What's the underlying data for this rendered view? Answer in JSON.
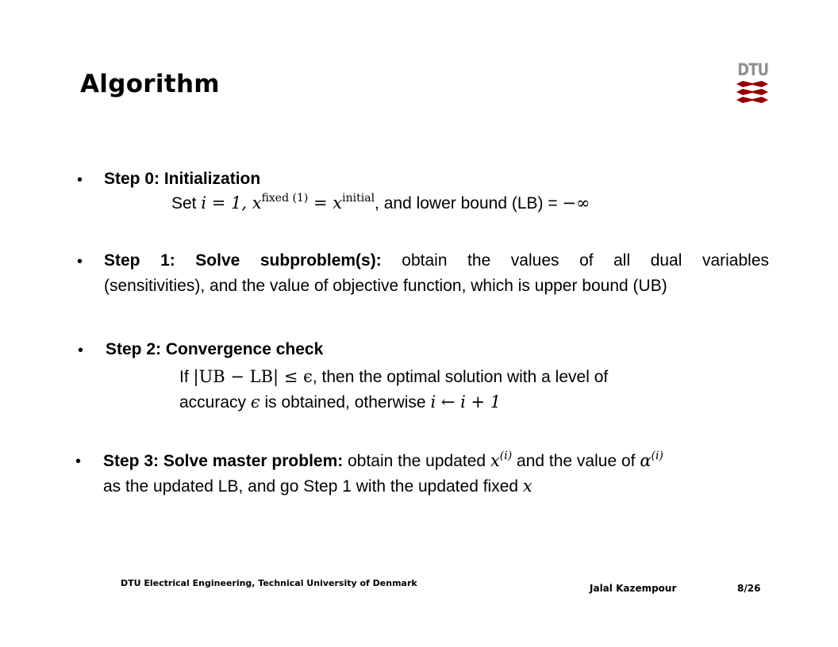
{
  "slide": {
    "title": "Algorithm",
    "logo_text": "DTU",
    "colors": {
      "logo_red": "#990000",
      "logo_gray": "#8f8f8f",
      "text": "#000000",
      "background": "#ffffff"
    }
  },
  "steps": [
    {
      "heading": "Step 0: Initialization",
      "line": {
        "set": "Set ",
        "eq1": "i = 1, x",
        "sup1": "fixed (1)",
        "eq2": " = x",
        "sup2": "initial",
        "rest": ",  and lower bound (LB) = ",
        "neg_inf": "−∞"
      }
    },
    {
      "heading": "Step 1: Solve subproblem(s):",
      "text_line1": "obtain the values of all dual variables",
      "text_line2": "(sensitivities), and the value of objective function, which is upper bound (UB)"
    },
    {
      "heading": "Step 2: Convergence check",
      "line1": {
        "if": "If ",
        "cond": "|UB − LB| ≤ ϵ",
        "rest": ", then the optimal solution with a level of"
      },
      "line2": {
        "accuracy": "accuracy ",
        "eps": "ϵ",
        "mid": " is obtained, otherwise  ",
        "update": "i ← i + 1"
      }
    },
    {
      "heading": "Step 3: Solve master problem:",
      "line1": {
        "pre": " obtain the updated ",
        "x": "x",
        "x_sup": "(i)",
        "mid": " and the value of ",
        "alpha": "α",
        "alpha_sup": "(i)"
      },
      "line2": {
        "pre": "as the updated LB, and go Step 1 with the updated fixed ",
        "x": "x"
      }
    }
  ],
  "footer": {
    "institution": "DTU Electrical Engineering, Technical University of Denmark",
    "author": "Jalal Kazempour",
    "page": "8/26"
  },
  "bullet_glyph": "•"
}
